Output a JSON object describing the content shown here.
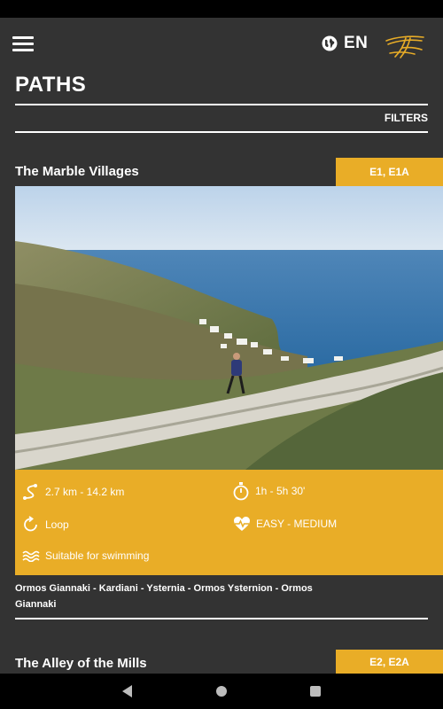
{
  "header": {
    "language": "EN",
    "title": "PATHS",
    "filters_label": "FILTERS"
  },
  "paths": [
    {
      "title": "The Marble Villages",
      "codes": "E1, E1A",
      "distance": "2.7 km - 14.2 km",
      "duration": "1h - 5h 30'",
      "route_type": "Loop",
      "difficulty": "EASY - MEDIUM",
      "feature": "Suitable for swimming",
      "route": "Ormos Giannaki - Kardiani - Ysternia - Ormos Ysternion - Ormos Giannaki"
    },
    {
      "title": "The Alley of the Mills",
      "codes": "E2, E2A"
    }
  ],
  "colors": {
    "background": "#333333",
    "accent": "#e9ad27",
    "text": "#ffffff",
    "system_bar": "#000000"
  },
  "icons": {
    "menu": "hamburger-menu-icon",
    "language": "globe-icon",
    "logo": "brand-logo",
    "distance": "path-distance-icon",
    "duration": "stopwatch-icon",
    "route_type": "loop-icon",
    "difficulty": "heartbeat-icon",
    "feature": "water-waves-icon",
    "nav_back": "back-triangle-icon",
    "nav_home": "home-circle-icon",
    "nav_recent": "recent-apps-square-icon"
  }
}
